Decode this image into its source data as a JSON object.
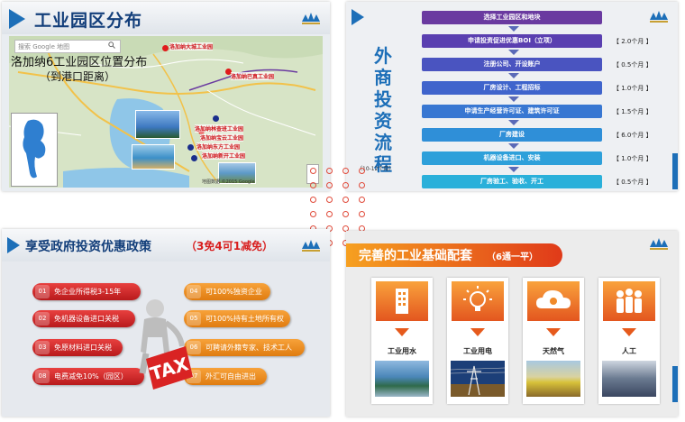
{
  "panel1": {
    "title": "工业园区分布",
    "search_placeholder": "搜索 Google 地图",
    "subtitle_line1": "洛加纳6工业园区位置分布",
    "subtitle_line2": "（到港口距离）",
    "pins": [
      "洛加纳大城工业园",
      "洛加纳巴真工业园",
      "洛加纳林查班工业园",
      "洛加纳宝云工业园",
      "洛加纳东方工业园",
      "洛加纳新开工业园"
    ],
    "copyright": "地图数据 ©2015 Google"
  },
  "panel2": {
    "vertical_title": [
      "外",
      "商",
      "投",
      "资",
      "流",
      "程"
    ],
    "subtitle": "（10-12个月）",
    "steps": [
      {
        "label": "选择工业园区和地块",
        "duration": ""
      },
      {
        "label": "申请投资促进优惠BOI（立项）",
        "duration": "【 2.0个月 】"
      },
      {
        "label": "注册公司、开设账户",
        "duration": "【 0.5个月 】"
      },
      {
        "label": "厂房设计、工程招标",
        "duration": "【 1.0个月 】"
      },
      {
        "label": "申请生产经营许可证、建筑许可证",
        "duration": "【 1.5个月 】"
      },
      {
        "label": "厂房建设",
        "duration": "【 6.0个月 】"
      },
      {
        "label": "机器设备进口、安装",
        "duration": "【 1.0个月 】"
      },
      {
        "label": "厂房验工、验收、开工",
        "duration": "【 0.5个月 】"
      }
    ],
    "colors": [
      "#6a3aa0",
      "#4a54c0",
      "#3f73cf",
      "#2f8fd8",
      "#2fa0da",
      "#2ab0da"
    ]
  },
  "panel3": {
    "title": "享受政府投资优惠政策",
    "subtitle": "（3免4可1减免）",
    "center_text": "TAX",
    "left_items": [
      {
        "num": "01",
        "text": "免企业所得税3-15年"
      },
      {
        "num": "02",
        "text": "免机器设备进口关税"
      },
      {
        "num": "03",
        "text": "免原材料进口关税"
      },
      {
        "num": "08",
        "text": "电费减免10%（园区）"
      }
    ],
    "right_items": [
      {
        "num": "04",
        "text": "可100%独资企业"
      },
      {
        "num": "05",
        "text": "可100%持有土地所有权"
      },
      {
        "num": "06",
        "text": "可聘请外籍专家、技术工人"
      },
      {
        "num": "07",
        "text": "外汇可自由进出"
      }
    ]
  },
  "panel4": {
    "title": "完善的工业基础配套",
    "subtitle": "（6通一平）",
    "columns": [
      {
        "label": "工业用水",
        "icon": "building-icon"
      },
      {
        "label": "工业用电",
        "icon": "lightbulb-icon"
      },
      {
        "label": "天然气",
        "icon": "cloud-icon"
      },
      {
        "label": "人工",
        "icon": "people-icon"
      }
    ]
  }
}
